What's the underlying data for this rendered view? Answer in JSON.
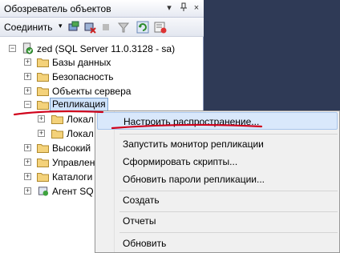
{
  "panel": {
    "title": "Обозреватель объектов",
    "controls": [
      "▾",
      "ᵖ",
      "×"
    ]
  },
  "toolbar": {
    "connect_label": "Соединить",
    "dropdown_glyph": "▾"
  },
  "tree": {
    "server": "zed (SQL Server 11.0.3128 - sa)",
    "items": [
      {
        "label": "Базы данных",
        "expander": "+"
      },
      {
        "label": "Безопасность",
        "expander": "+"
      },
      {
        "label": "Объекты сервера",
        "expander": "+"
      },
      {
        "label": "Репликация",
        "expander": "−",
        "selected": true
      },
      {
        "label": "Локал",
        "expander": "+"
      },
      {
        "label": "Локал",
        "expander": "+"
      },
      {
        "label": "Высокий",
        "expander": "+"
      },
      {
        "label": "Управлен",
        "expander": "+"
      },
      {
        "label": "Каталоги",
        "expander": "+"
      },
      {
        "label": "Агент SQ",
        "expander": "+"
      }
    ]
  },
  "context_menu": {
    "items": [
      {
        "label": "Настроить распространение...",
        "highlighted": true
      },
      {
        "label": "Запустить монитор репликации"
      },
      {
        "label": "Сформировать скрипты..."
      },
      {
        "label": "Обновить пароли репликации..."
      },
      {
        "label": "Создать"
      },
      {
        "label": "Отчеты"
      },
      {
        "label": "Обновить"
      }
    ]
  },
  "colors": {
    "annotation_red": "#d0021b",
    "selection": "#cfe3fb",
    "menu_highlight": "#d9e8fb"
  }
}
